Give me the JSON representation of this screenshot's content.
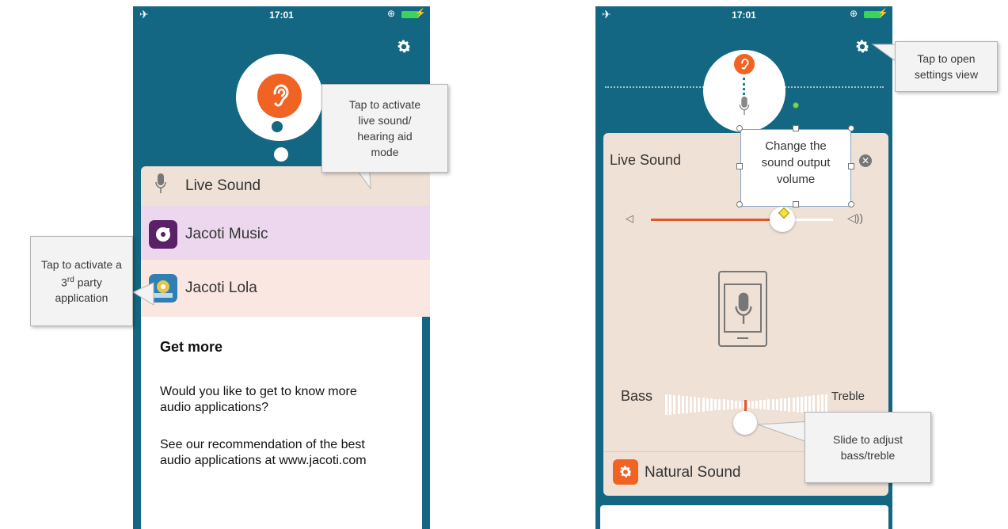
{
  "left_phone": {
    "status": {
      "time": "17:01"
    },
    "rows": [
      {
        "label": "Live Sound",
        "icon": "microphone-icon",
        "bg": "#efe1d6"
      },
      {
        "label": "Jacoti Music",
        "icon": "jacoti-music-icon",
        "bg": "#ecd7ee"
      },
      {
        "label": "Jacoti Lola",
        "icon": "jacoti-lola-icon",
        "bg": "#fbe7e1"
      }
    ],
    "get_more": {
      "title": "Get more",
      "text1_line1": "Would you like to get to know more",
      "text1_line2": "audio applications?",
      "text2_line1": "See our recommendation of the best",
      "text2_line2": "audio applications at www.jacoti.com"
    }
  },
  "right_phone": {
    "status": {
      "time": "17:01"
    },
    "card_title": "Live Sound",
    "volume_level": 0.72,
    "bass_label": "Bass",
    "treble_label": "Treble",
    "bass_treble_level": 0.5,
    "mode_label": "Natural Sound",
    "textbox": {
      "line1": "Change the",
      "line2": "sound output",
      "line3": "volume"
    }
  },
  "callouts": {
    "live_sound": {
      "line1": "Tap to activate",
      "line2": "live sound/",
      "line3": "hearing aid",
      "line4": "mode"
    },
    "third_party": {
      "line1": "Tap to activate a",
      "line2_pre": "3",
      "line2_sup": "rd",
      "line2_post": " party",
      "line3": "application"
    },
    "settings": {
      "line1": "Tap to open",
      "line2": "settings view"
    },
    "bass_treble": {
      "line1": "Slide to adjust",
      "line2": "bass/treble"
    }
  },
  "colors": {
    "background": "#136782",
    "accent": "#f06323",
    "card": "#efe1d6",
    "music_row": "#ecd7ee",
    "lola_row": "#fbe7e1"
  }
}
